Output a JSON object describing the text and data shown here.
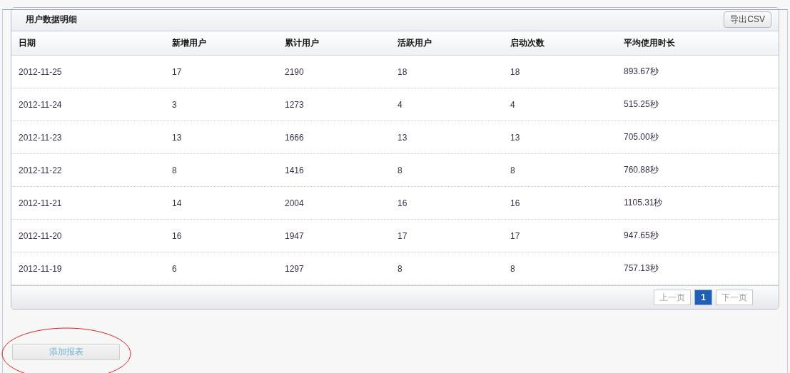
{
  "panel": {
    "title": "用户数据明细",
    "export_button": "导出CSV"
  },
  "table": {
    "columns": [
      "日期",
      "新增用户",
      "累计用户",
      "活跃用户",
      "启动次数",
      "平均使用时长"
    ],
    "rows": [
      [
        "2012-11-25",
        "17",
        "2190",
        "18",
        "18",
        "893.67秒"
      ],
      [
        "2012-11-24",
        "3",
        "1273",
        "4",
        "4",
        "515.25秒"
      ],
      [
        "2012-11-23",
        "13",
        "1666",
        "13",
        "13",
        "705.00秒"
      ],
      [
        "2012-11-22",
        "8",
        "1416",
        "8",
        "8",
        "760.88秒"
      ],
      [
        "2012-11-21",
        "14",
        "2004",
        "16",
        "16",
        "1105.31秒"
      ],
      [
        "2012-11-20",
        "16",
        "1947",
        "17",
        "17",
        "947.65秒"
      ],
      [
        "2012-11-19",
        "6",
        "1297",
        "8",
        "8",
        "757.13秒"
      ]
    ]
  },
  "pagination": [
    {
      "kind": "prev",
      "label": "上一页",
      "disabled": true
    },
    {
      "kind": "page",
      "label": "1",
      "selected": true
    },
    {
      "kind": "next",
      "label": "下一页",
      "disabled": true
    }
  ],
  "add_report_button": {
    "label": "添加报表"
  }
}
